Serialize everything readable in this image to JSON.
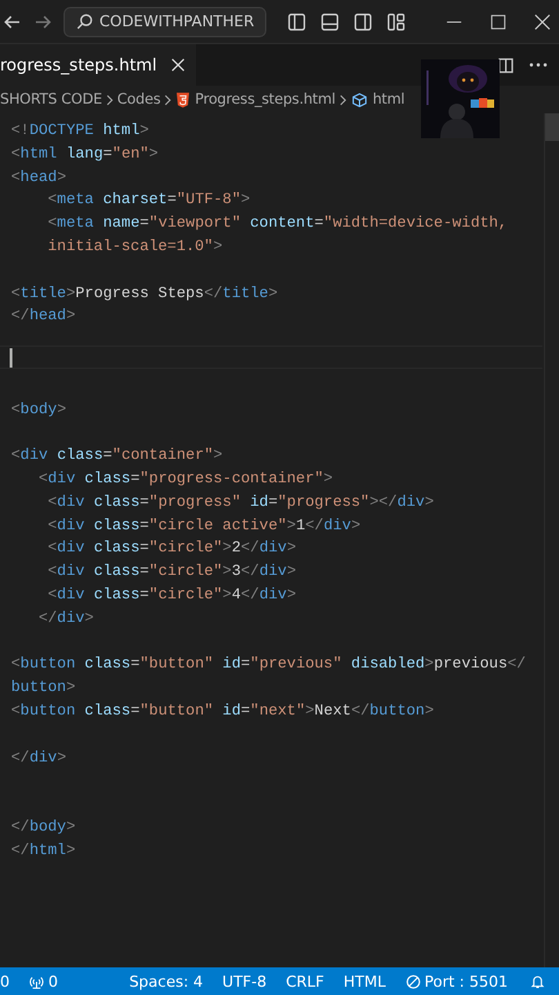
{
  "title_bar": {
    "search": "CODEWITHPANTHER"
  },
  "tabs": [
    {
      "label": "rogress_steps.html",
      "selected": true
    }
  ],
  "breadcrumbs": [
    {
      "kind": "folder",
      "text": "SHORTS CODE"
    },
    {
      "kind": "folder",
      "text": "Codes"
    },
    {
      "kind": "file",
      "text": "Progress_steps.html"
    },
    {
      "kind": "symbol",
      "text": "html"
    }
  ],
  "editor": {
    "lines": [
      {
        "current": false,
        "tokens": [
          {
            "kind": "punct",
            "text": "<!"
          },
          {
            "kind": "tag",
            "text": "DOCTYPE"
          },
          {
            "kind": "attribute",
            "text": " html"
          },
          {
            "kind": "punct",
            "text": ">"
          }
        ]
      },
      {
        "current": false,
        "tokens": [
          {
            "kind": "punct",
            "text": "<"
          },
          {
            "kind": "tag",
            "text": "html"
          },
          {
            "kind": "attribute",
            "text": " lang"
          },
          {
            "kind": "plain",
            "text": "="
          },
          {
            "kind": "string",
            "text": "\"en\""
          },
          {
            "kind": "punct",
            "text": ">"
          }
        ]
      },
      {
        "current": false,
        "tokens": [
          {
            "kind": "punct",
            "text": "<"
          },
          {
            "kind": "tag",
            "text": "head"
          },
          {
            "kind": "punct",
            "text": ">"
          }
        ]
      },
      {
        "current": false,
        "tokens": [
          {
            "kind": "punct",
            "text": "    <"
          },
          {
            "kind": "tag",
            "text": "meta"
          },
          {
            "kind": "attribute",
            "text": " charset"
          },
          {
            "kind": "plain",
            "text": "="
          },
          {
            "kind": "string",
            "text": "\"UTF-8\""
          },
          {
            "kind": "punct",
            "text": ">"
          }
        ]
      },
      {
        "current": false,
        "tokens": [
          {
            "kind": "punct",
            "text": "    <"
          },
          {
            "kind": "tag",
            "text": "meta"
          },
          {
            "kind": "attribute",
            "text": " name"
          },
          {
            "kind": "plain",
            "text": "="
          },
          {
            "kind": "string",
            "text": "\"viewport\""
          },
          {
            "kind": "attribute",
            "text": " content"
          },
          {
            "kind": "plain",
            "text": "="
          },
          {
            "kind": "string",
            "text": "\"width=device-width,"
          }
        ]
      },
      {
        "current": false,
        "tokens": [
          {
            "kind": "string",
            "text": "    initial-scale=1.0\""
          },
          {
            "kind": "punct",
            "text": ">"
          }
        ]
      },
      {
        "current": false
      },
      {
        "current": false,
        "tokens": [
          {
            "kind": "punct",
            "text": "<"
          },
          {
            "kind": "tag",
            "text": "title"
          },
          {
            "kind": "punct",
            "text": ">"
          },
          {
            "kind": "plain",
            "text": "Progress Steps"
          },
          {
            "kind": "punct",
            "text": "</"
          },
          {
            "kind": "tag",
            "text": "title"
          },
          {
            "kind": "punct",
            "text": ">"
          }
        ]
      },
      {
        "current": false,
        "tokens": [
          {
            "kind": "punct",
            "text": "</"
          },
          {
            "kind": "tag",
            "text": "head"
          },
          {
            "kind": "punct",
            "text": ">"
          }
        ]
      },
      {
        "current": false
      },
      {
        "current": true
      },
      {
        "current": false
      },
      {
        "current": false,
        "tokens": [
          {
            "kind": "punct",
            "text": "<"
          },
          {
            "kind": "tag",
            "text": "body"
          },
          {
            "kind": "punct",
            "text": ">"
          }
        ]
      },
      {
        "current": false
      },
      {
        "current": false,
        "tokens": [
          {
            "kind": "punct",
            "text": "<"
          },
          {
            "kind": "tag",
            "text": "div"
          },
          {
            "kind": "attribute",
            "text": " class"
          },
          {
            "kind": "plain",
            "text": "="
          },
          {
            "kind": "string",
            "text": "\"container\""
          },
          {
            "kind": "punct",
            "text": ">"
          }
        ]
      },
      {
        "current": false,
        "tokens": [
          {
            "kind": "punct",
            "text": "   <"
          },
          {
            "kind": "tag",
            "text": "div"
          },
          {
            "kind": "attribute",
            "text": " class"
          },
          {
            "kind": "plain",
            "text": "="
          },
          {
            "kind": "string",
            "text": "\"progress-container\""
          },
          {
            "kind": "punct",
            "text": ">"
          }
        ]
      },
      {
        "current": false,
        "tokens": [
          {
            "kind": "punct",
            "text": "    <"
          },
          {
            "kind": "tag",
            "text": "div"
          },
          {
            "kind": "attribute",
            "text": " class"
          },
          {
            "kind": "plain",
            "text": "="
          },
          {
            "kind": "string",
            "text": "\"progress\""
          },
          {
            "kind": "attribute",
            "text": " id"
          },
          {
            "kind": "plain",
            "text": "="
          },
          {
            "kind": "string",
            "text": "\"progress\""
          },
          {
            "kind": "punct",
            "text": "></"
          },
          {
            "kind": "tag",
            "text": "div"
          },
          {
            "kind": "punct",
            "text": ">"
          }
        ]
      },
      {
        "current": false,
        "tokens": [
          {
            "kind": "punct",
            "text": "    <"
          },
          {
            "kind": "tag",
            "text": "div"
          },
          {
            "kind": "attribute",
            "text": " class"
          },
          {
            "kind": "plain",
            "text": "="
          },
          {
            "kind": "string",
            "text": "\"circle active\""
          },
          {
            "kind": "punct",
            "text": ">"
          },
          {
            "kind": "plain",
            "text": "1"
          },
          {
            "kind": "punct",
            "text": "</"
          },
          {
            "kind": "tag",
            "text": "div"
          },
          {
            "kind": "punct",
            "text": ">"
          }
        ]
      },
      {
        "current": false,
        "tokens": [
          {
            "kind": "punct",
            "text": "    <"
          },
          {
            "kind": "tag",
            "text": "div"
          },
          {
            "kind": "attribute",
            "text": " class"
          },
          {
            "kind": "plain",
            "text": "="
          },
          {
            "kind": "string",
            "text": "\"circle\""
          },
          {
            "kind": "punct",
            "text": ">"
          },
          {
            "kind": "plain",
            "text": "2"
          },
          {
            "kind": "punct",
            "text": "</"
          },
          {
            "kind": "tag",
            "text": "div"
          },
          {
            "kind": "punct",
            "text": ">"
          }
        ]
      },
      {
        "current": false,
        "tokens": [
          {
            "kind": "punct",
            "text": "    <"
          },
          {
            "kind": "tag",
            "text": "div"
          },
          {
            "kind": "attribute",
            "text": " class"
          },
          {
            "kind": "plain",
            "text": "="
          },
          {
            "kind": "string",
            "text": "\"circle\""
          },
          {
            "kind": "punct",
            "text": ">"
          },
          {
            "kind": "plain",
            "text": "3"
          },
          {
            "kind": "punct",
            "text": "</"
          },
          {
            "kind": "tag",
            "text": "div"
          },
          {
            "kind": "punct",
            "text": ">"
          }
        ]
      },
      {
        "current": false,
        "tokens": [
          {
            "kind": "punct",
            "text": "    <"
          },
          {
            "kind": "tag",
            "text": "div"
          },
          {
            "kind": "attribute",
            "text": " class"
          },
          {
            "kind": "plain",
            "text": "="
          },
          {
            "kind": "string",
            "text": "\"circle\""
          },
          {
            "kind": "punct",
            "text": ">"
          },
          {
            "kind": "plain",
            "text": "4"
          },
          {
            "kind": "punct",
            "text": "</"
          },
          {
            "kind": "tag",
            "text": "div"
          },
          {
            "kind": "punct",
            "text": ">"
          }
        ]
      },
      {
        "current": false,
        "tokens": [
          {
            "kind": "punct",
            "text": "   </"
          },
          {
            "kind": "tag",
            "text": "div"
          },
          {
            "kind": "punct",
            "text": ">"
          }
        ]
      },
      {
        "current": false
      },
      {
        "current": false,
        "tokens": [
          {
            "kind": "punct",
            "text": "<"
          },
          {
            "kind": "tag",
            "text": "button"
          },
          {
            "kind": "attribute",
            "text": " class"
          },
          {
            "kind": "plain",
            "text": "="
          },
          {
            "kind": "string",
            "text": "\"button\""
          },
          {
            "kind": "attribute",
            "text": " id"
          },
          {
            "kind": "plain",
            "text": "="
          },
          {
            "kind": "string",
            "text": "\"previous\""
          },
          {
            "kind": "attribute",
            "text": " disabled"
          },
          {
            "kind": "punct",
            "text": ">"
          },
          {
            "kind": "plain",
            "text": "previous"
          },
          {
            "kind": "punct",
            "text": "</"
          }
        ]
      },
      {
        "current": false,
        "tokens": [
          {
            "kind": "tag",
            "text": "button"
          },
          {
            "kind": "punct",
            "text": ">"
          }
        ]
      },
      {
        "current": false,
        "tokens": [
          {
            "kind": "punct",
            "text": "<"
          },
          {
            "kind": "tag",
            "text": "button"
          },
          {
            "kind": "attribute",
            "text": " class"
          },
          {
            "kind": "plain",
            "text": "="
          },
          {
            "kind": "string",
            "text": "\"button\""
          },
          {
            "kind": "attribute",
            "text": " id"
          },
          {
            "kind": "plain",
            "text": "="
          },
          {
            "kind": "string",
            "text": "\"next\""
          },
          {
            "kind": "punct",
            "text": ">"
          },
          {
            "kind": "plain",
            "text": "Next"
          },
          {
            "kind": "punct",
            "text": "</"
          },
          {
            "kind": "tag",
            "text": "button"
          },
          {
            "kind": "punct",
            "text": ">"
          }
        ]
      },
      {
        "current": false
      },
      {
        "current": false,
        "tokens": [
          {
            "kind": "punct",
            "text": "</"
          },
          {
            "kind": "tag",
            "text": "div"
          },
          {
            "kind": "punct",
            "text": ">"
          }
        ]
      },
      {
        "current": false
      },
      {
        "current": false
      },
      {
        "current": false,
        "tokens": [
          {
            "kind": "punct",
            "text": "</"
          },
          {
            "kind": "tag",
            "text": "body"
          },
          {
            "kind": "punct",
            "text": ">"
          }
        ]
      },
      {
        "current": false,
        "tokens": [
          {
            "kind": "punct",
            "text": "</"
          },
          {
            "kind": "tag",
            "text": "html"
          },
          {
            "kind": "punct",
            "text": ">"
          }
        ]
      }
    ]
  },
  "status_bar": [
    {
      "kind": "errors",
      "text": "0"
    },
    {
      "kind": "ports",
      "text": "0"
    },
    {
      "kind": "plain",
      "text": "Spaces: 4"
    },
    {
      "kind": "plain",
      "text": "UTF-8"
    },
    {
      "kind": "plain",
      "text": "CRLF"
    },
    {
      "kind": "plain",
      "text": "HTML"
    },
    {
      "kind": "server",
      "text": "Port : 5501"
    }
  ]
}
